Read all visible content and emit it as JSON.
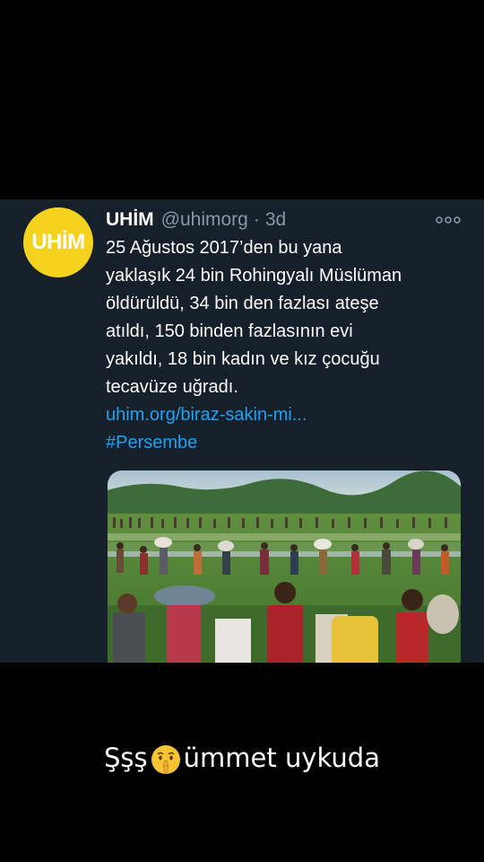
{
  "tweet": {
    "avatar_text": "UHİM",
    "display_name": "UHİM",
    "handle": "@uhimorg",
    "separator": "·",
    "time": "3d",
    "lines": [
      "25 Ağustos 2017’den bu yana",
      "yaklaşık 24 bin Rohingyalı Müslüman",
      "öldürüldü, 34 bin den fazlası ateşe",
      "atıldı, 150 binden fazlasının evi",
      "yakıldı, 18 bin kadın ve kız çocuğu",
      "tecavüze uğradı."
    ],
    "link": "uhim.org/biraz-sakin-mi...",
    "hashtag": "#Persembe"
  },
  "caption": {
    "before": "Şşş",
    "after": "ümmet uykuda",
    "emoji": "shushing-face-icon"
  },
  "colors": {
    "tweet_bg": "#15202b",
    "accent_blue": "#1da1f2",
    "muted_text": "#8899a6",
    "avatar_yellow": "#f5d21e"
  }
}
